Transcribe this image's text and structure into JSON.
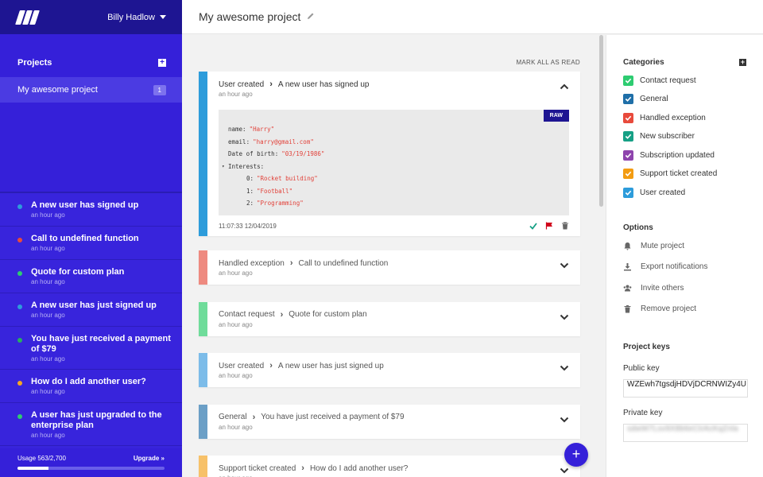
{
  "sidebar": {
    "user_name": "Billy Hadlow",
    "projects_label": "Projects",
    "add_icon": "plus-square-icon",
    "project": {
      "name": "My awesome project",
      "count": "1"
    },
    "feed": [
      {
        "title": "A new user has signed up",
        "time": "an hour ago",
        "color": "#2d9cdb"
      },
      {
        "title": "Call to undefined function",
        "time": "an hour ago",
        "color": "#e84a3c"
      },
      {
        "title": "Quote for custom plan",
        "time": "an hour ago",
        "color": "#2ecc71"
      },
      {
        "title": "A new user has just signed up",
        "time": "an hour ago",
        "color": "#2d9cdb"
      },
      {
        "title": "You have just received a payment of $79",
        "time": "an hour ago",
        "color": "#27ae60"
      },
      {
        "title": "How do I add another user?",
        "time": "an hour ago",
        "color": "#f5a623"
      },
      {
        "title": "A user has just upgraded to the enterprise plan",
        "time": "an hour ago",
        "color": "#2ecc71"
      }
    ],
    "usage_label": "Usage 563/2,700",
    "usage_fraction": 0.2085,
    "upgrade_label": "Upgrade",
    "upgrade_icon": "double-chevron-right-icon"
  },
  "header": {
    "title": "My awesome project",
    "edit_icon": "pencil-icon"
  },
  "main": {
    "mark_all_label": "MARK ALL AS READ",
    "expanded": {
      "category": "User created",
      "message": "A new user has signed up",
      "time": "an hour ago",
      "color": "#2d9cdb",
      "raw_label": "RAW",
      "code": {
        "name_key": "name:",
        "name_val": "\"Harry\"",
        "email_key": "email:",
        "email_val": "\"harry@gmail.com\"",
        "dob_key": "Date of birth:",
        "dob_val": "\"03/19/1986\"",
        "interests_key": "Interests:",
        "i0_key": "0:",
        "i0_val": "\"Rocket building\"",
        "i1_key": "1:",
        "i1_val": "\"Football\"",
        "i2_key": "2:",
        "i2_val": "\"Programming\""
      },
      "timestamp": "11:07:33 12/04/2019",
      "actions": [
        "check-icon",
        "flag-icon",
        "trash-icon"
      ]
    },
    "collapsed": [
      {
        "category": "Handled exception",
        "message": "Call to undefined function",
        "time": "an hour ago",
        "color": "#ee8a80"
      },
      {
        "category": "Contact request",
        "message": "Quote for custom plan",
        "time": "an hour ago",
        "color": "#6fdc9a"
      },
      {
        "category": "User created",
        "message": "A new user has just signed up",
        "time": "an hour ago",
        "color": "#7cbce9"
      },
      {
        "category": "General",
        "message": "You have just received a payment of $79",
        "time": "an hour ago",
        "color": "#6b9fc6"
      },
      {
        "category": "Support ticket created",
        "message": "How do I add another user?",
        "time": "an hour ago",
        "color": "#f7c169"
      }
    ],
    "fab_label": "+"
  },
  "right": {
    "categories_title": "Categories",
    "categories": [
      {
        "label": "Contact request",
        "color": "#2ecc71"
      },
      {
        "label": "General",
        "color": "#1f6fa8"
      },
      {
        "label": "Handled exception",
        "color": "#e84a3c"
      },
      {
        "label": "New subscriber",
        "color": "#16a085"
      },
      {
        "label": "Subscription updated",
        "color": "#8e44ad"
      },
      {
        "label": "Support ticket created",
        "color": "#f39c12"
      },
      {
        "label": "User created",
        "color": "#2d9cdb"
      }
    ],
    "options_title": "Options",
    "options": [
      {
        "label": "Mute project",
        "icon": "bell-icon"
      },
      {
        "label": "Export notifications",
        "icon": "download-icon"
      },
      {
        "label": "Invite others",
        "icon": "users-icon"
      },
      {
        "label": "Remove project",
        "icon": "trash-icon"
      }
    ],
    "keys_title": "Project keys",
    "public_label": "Public key",
    "public_value": "WZEwh7tgsdjHDVjDCRNWIZy4U",
    "private_label": "Private key",
    "private_value": "sdwW7Lsv9X8b6eCtrAcKqZnla"
  }
}
